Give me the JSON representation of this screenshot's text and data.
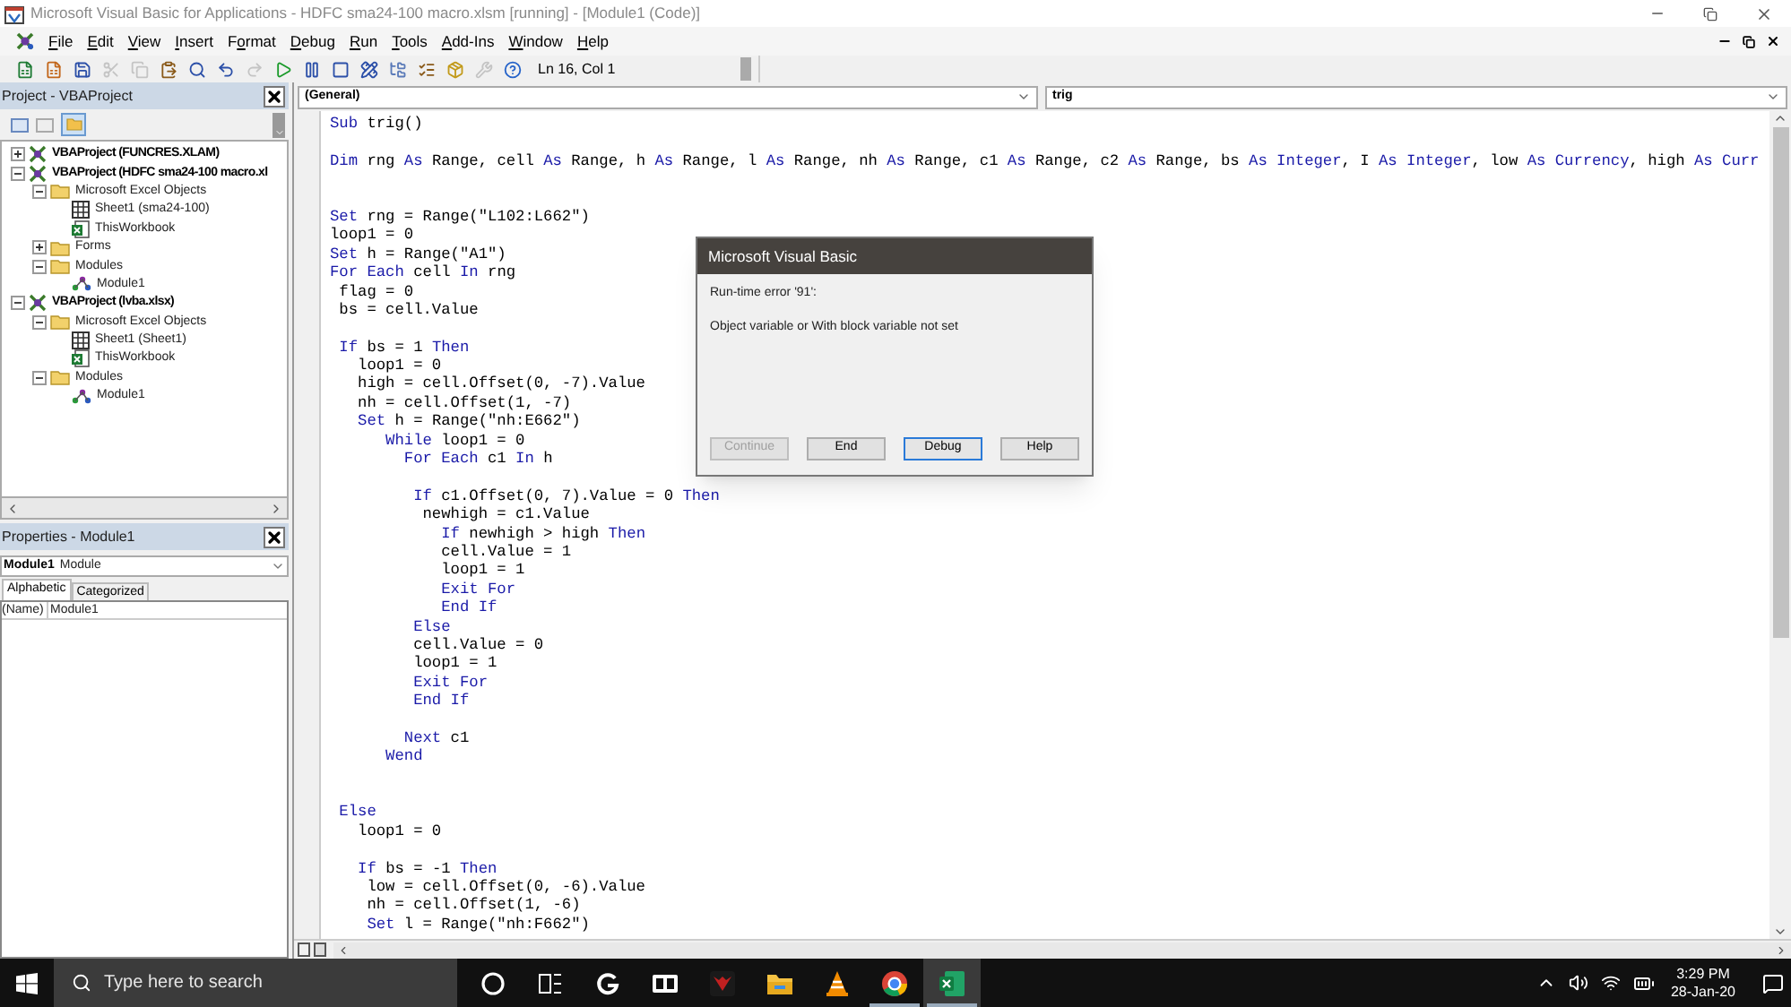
{
  "window": {
    "title": "Microsoft Visual Basic for Applications - HDFC sma24-100 macro.xlsm [running] - [Module1 (Code)]"
  },
  "menu": [
    {
      "key": "F",
      "post": "ile"
    },
    {
      "key": "E",
      "post": "dit"
    },
    {
      "key": "V",
      "post": "iew"
    },
    {
      "key": "I",
      "post": "nsert"
    },
    {
      "pre": "F",
      "key": "o",
      "post": "rmat"
    },
    {
      "key": "D",
      "post": "ebug"
    },
    {
      "key": "R",
      "post": "un"
    },
    {
      "key": "T",
      "post": "ools"
    },
    {
      "key": "A",
      "post": "dd-Ins"
    },
    {
      "key": "W",
      "post": "indow"
    },
    {
      "key": "H",
      "post": "elp"
    }
  ],
  "toolbar": {
    "buttons": [
      {
        "kind": "excel",
        "disabled": false
      },
      {
        "kind": "insert",
        "disabled": false
      },
      {
        "kind": "save",
        "disabled": false
      },
      {
        "kind": "cut",
        "disabled": true
      },
      {
        "kind": "copy",
        "disabled": true
      },
      {
        "kind": "paste",
        "disabled": false
      },
      {
        "kind": "find",
        "disabled": false
      },
      {
        "kind": "undo",
        "disabled": false
      },
      {
        "kind": "redo",
        "disabled": true
      },
      {
        "kind": "run",
        "disabled": false
      },
      {
        "kind": "break",
        "disabled": false
      },
      {
        "kind": "reset",
        "disabled": false
      },
      {
        "kind": "design",
        "disabled": false
      },
      {
        "kind": "project",
        "disabled": false
      },
      {
        "kind": "properties",
        "disabled": false
      },
      {
        "kind": "browser",
        "disabled": false
      },
      {
        "kind": "toolbox",
        "disabled": true
      },
      {
        "kind": "help",
        "disabled": false
      }
    ],
    "position": "Ln 16, Col 1"
  },
  "project": {
    "title": "Project - VBAProject",
    "tree": [
      {
        "label": "VBAProject (FUNCRES.XLAM)",
        "kind": "project",
        "expanded": false
      },
      {
        "label": "VBAProject (HDFC sma24-100 macro.xl",
        "kind": "project",
        "expanded": true,
        "children": [
          {
            "label": "Microsoft Excel Objects",
            "kind": "folder",
            "expanded": true,
            "children": [
              {
                "label": "Sheet1 (sma24-100)",
                "kind": "sheet"
              },
              {
                "label": "ThisWorkbook",
                "kind": "workbook"
              }
            ]
          },
          {
            "label": "Forms",
            "kind": "folder",
            "expanded": false
          },
          {
            "label": "Modules",
            "kind": "folder",
            "expanded": true,
            "children": [
              {
                "label": "Module1",
                "kind": "module"
              }
            ]
          }
        ]
      },
      {
        "label": "VBAProject (lvba.xlsx)",
        "kind": "project",
        "expanded": true,
        "children": [
          {
            "label": "Microsoft Excel Objects",
            "kind": "folder",
            "expanded": true,
            "children": [
              {
                "label": "Sheet1 (Sheet1)",
                "kind": "sheet"
              },
              {
                "label": "ThisWorkbook",
                "kind": "workbook"
              }
            ]
          },
          {
            "label": "Modules",
            "kind": "folder",
            "expanded": true,
            "children": [
              {
                "label": "Module1",
                "kind": "module"
              }
            ]
          }
        ]
      }
    ]
  },
  "properties": {
    "title": "Properties - Module1",
    "object_name": "Module1",
    "object_type": "Module",
    "tabs": [
      {
        "label": "Alphabetic",
        "selected": true
      },
      {
        "label": "Categorized",
        "selected": false
      }
    ],
    "rows": [
      {
        "name": "(Name)",
        "value": "Module1"
      }
    ]
  },
  "code": {
    "object": "(General)",
    "procedure": "trig",
    "lines": [
      {
        "kind": "code",
        "segments": [
          {
            "text": "Sub",
            "kind": "keyword"
          },
          {
            "text": " trig()",
            "kind": "plain"
          }
        ]
      },
      {
        "kind": "blank"
      },
      {
        "kind": "code",
        "segments": [
          {
            "text": "Dim",
            "kind": "keyword"
          },
          {
            "text": " rng ",
            "kind": "plain"
          },
          {
            "text": "As",
            "kind": "keyword"
          },
          {
            "text": " Range, cell ",
            "kind": "plain"
          },
          {
            "text": "As",
            "kind": "keyword"
          },
          {
            "text": " Range, h ",
            "kind": "plain"
          },
          {
            "text": "As",
            "kind": "keyword"
          },
          {
            "text": " Range, l ",
            "kind": "plain"
          },
          {
            "text": "As",
            "kind": "keyword"
          },
          {
            "text": " Range, nh ",
            "kind": "plain"
          },
          {
            "text": "As",
            "kind": "keyword"
          },
          {
            "text": " Range, c1 ",
            "kind": "plain"
          },
          {
            "text": "As",
            "kind": "keyword"
          },
          {
            "text": " Range, c2 ",
            "kind": "plain"
          },
          {
            "text": "As",
            "kind": "keyword"
          },
          {
            "text": " Range, bs ",
            "kind": "plain"
          },
          {
            "text": "As Integer",
            "kind": "keyword"
          },
          {
            "text": ", I ",
            "kind": "plain"
          },
          {
            "text": "As Integer",
            "kind": "keyword"
          },
          {
            "text": ", low ",
            "kind": "plain"
          },
          {
            "text": "As Currency",
            "kind": "keyword"
          },
          {
            "text": ", high ",
            "kind": "plain"
          },
          {
            "text": "As Curr",
            "kind": "keyword"
          }
        ]
      },
      {
        "kind": "blank"
      },
      {
        "kind": "blank"
      },
      {
        "kind": "code",
        "segments": [
          {
            "text": "Set",
            "kind": "keyword"
          },
          {
            "text": " rng = Range(\"L102:L662\")",
            "kind": "plain"
          }
        ]
      },
      {
        "kind": "code",
        "segments": [
          {
            "text": "loop1 = 0",
            "kind": "plain"
          }
        ]
      },
      {
        "kind": "code",
        "segments": [
          {
            "text": "Set",
            "kind": "keyword"
          },
          {
            "text": " h = Range(\"A1\")",
            "kind": "plain"
          }
        ]
      },
      {
        "kind": "code",
        "segments": [
          {
            "text": "For Each",
            "kind": "keyword"
          },
          {
            "text": " cell ",
            "kind": "plain"
          },
          {
            "text": "In",
            "kind": "keyword"
          },
          {
            "text": " rng",
            "kind": "plain"
          }
        ]
      },
      {
        "kind": "code",
        "segments": [
          {
            "text": " flag = 0",
            "kind": "plain"
          }
        ]
      },
      {
        "kind": "code",
        "segments": [
          {
            "text": " bs = cell.Value",
            "kind": "plain"
          }
        ]
      },
      {
        "kind": "blank"
      },
      {
        "kind": "code",
        "segments": [
          {
            "text": " If",
            "kind": "keyword"
          },
          {
            "text": " bs = 1 ",
            "kind": "plain"
          },
          {
            "text": "Then",
            "kind": "keyword"
          }
        ]
      },
      {
        "kind": "code",
        "segments": [
          {
            "text": "   loop1 = 0",
            "kind": "plain"
          }
        ]
      },
      {
        "kind": "code",
        "segments": [
          {
            "text": "   high = cell.Offset(0, -7).Value",
            "kind": "plain"
          }
        ]
      },
      {
        "kind": "code",
        "segments": [
          {
            "text": "   nh = cell.Offset(1, -7)",
            "kind": "plain"
          }
        ]
      },
      {
        "kind": "code",
        "segments": [
          {
            "text": "   Set",
            "kind": "keyword"
          },
          {
            "text": " h = Range(\"nh:E662\")",
            "kind": "plain"
          }
        ]
      },
      {
        "kind": "code",
        "segments": [
          {
            "text": "      While",
            "kind": "keyword"
          },
          {
            "text": " loop1 = 0",
            "kind": "plain"
          }
        ]
      },
      {
        "kind": "code",
        "segments": [
          {
            "text": "        For Each",
            "kind": "keyword"
          },
          {
            "text": " c1 ",
            "kind": "plain"
          },
          {
            "text": "In",
            "kind": "keyword"
          },
          {
            "text": " h",
            "kind": "plain"
          }
        ]
      },
      {
        "kind": "blank"
      },
      {
        "kind": "code",
        "segments": [
          {
            "text": "         If",
            "kind": "keyword"
          },
          {
            "text": " c1.Offset(0, 7).Value = 0 ",
            "kind": "plain"
          },
          {
            "text": "Then",
            "kind": "keyword"
          }
        ]
      },
      {
        "kind": "code",
        "segments": [
          {
            "text": "          newhigh = c1.Value",
            "kind": "plain"
          }
        ]
      },
      {
        "kind": "code",
        "segments": [
          {
            "text": "            If",
            "kind": "keyword"
          },
          {
            "text": " newhigh > high ",
            "kind": "plain"
          },
          {
            "text": "Then",
            "kind": "keyword"
          }
        ]
      },
      {
        "kind": "code",
        "segments": [
          {
            "text": "            cell.Value = 1",
            "kind": "plain"
          }
        ]
      },
      {
        "kind": "code",
        "segments": [
          {
            "text": "            loop1 = 1",
            "kind": "plain"
          }
        ]
      },
      {
        "kind": "code",
        "segments": [
          {
            "text": "            Exit For",
            "kind": "keyword"
          }
        ]
      },
      {
        "kind": "code",
        "segments": [
          {
            "text": "            End If",
            "kind": "keyword"
          }
        ]
      },
      {
        "kind": "code",
        "segments": [
          {
            "text": "         Else",
            "kind": "keyword"
          }
        ]
      },
      {
        "kind": "code",
        "segments": [
          {
            "text": "         cell.Value = 0",
            "kind": "plain"
          }
        ]
      },
      {
        "kind": "code",
        "segments": [
          {
            "text": "         loop1 = 1",
            "kind": "plain"
          }
        ]
      },
      {
        "kind": "code",
        "segments": [
          {
            "text": "         Exit For",
            "kind": "keyword"
          }
        ]
      },
      {
        "kind": "code",
        "segments": [
          {
            "text": "         End If",
            "kind": "keyword"
          }
        ]
      },
      {
        "kind": "blank"
      },
      {
        "kind": "code",
        "segments": [
          {
            "text": "        Next",
            "kind": "keyword"
          },
          {
            "text": " c1",
            "kind": "plain"
          }
        ]
      },
      {
        "kind": "code",
        "segments": [
          {
            "text": "      Wend",
            "kind": "keyword"
          }
        ]
      },
      {
        "kind": "blank"
      },
      {
        "kind": "blank"
      },
      {
        "kind": "code",
        "segments": [
          {
            "text": " Else",
            "kind": "keyword"
          }
        ]
      },
      {
        "kind": "code",
        "segments": [
          {
            "text": "   loop1 = 0",
            "kind": "plain"
          }
        ]
      },
      {
        "kind": "blank"
      },
      {
        "kind": "code",
        "segments": [
          {
            "text": "   If",
            "kind": "keyword"
          },
          {
            "text": " bs = -1 ",
            "kind": "plain"
          },
          {
            "text": "Then",
            "kind": "keyword"
          }
        ]
      },
      {
        "kind": "code",
        "segments": [
          {
            "text": "    low = cell.Offset(0, -6).Value",
            "kind": "plain"
          }
        ]
      },
      {
        "kind": "code",
        "segments": [
          {
            "text": "    nh = cell.Offset(1, -6)",
            "kind": "plain"
          }
        ]
      },
      {
        "kind": "code",
        "segments": [
          {
            "text": "    Set",
            "kind": "keyword"
          },
          {
            "text": " l = Range(\"nh:F662\")",
            "kind": "plain"
          }
        ]
      }
    ]
  },
  "dialog": {
    "title": "Microsoft Visual Basic",
    "messages": [
      "Run-time error '91':",
      "Object variable or With block variable not set"
    ],
    "buttons": [
      {
        "label": "Continue",
        "disabled": true,
        "focused": false
      },
      {
        "label": "End",
        "disabled": false,
        "focused": false
      },
      {
        "label": "Debug",
        "disabled": false,
        "focused": true
      },
      {
        "label": "Help",
        "disabled": false,
        "focused": false
      }
    ]
  },
  "taskbar": {
    "search": {
      "placeholder": "Type here to search"
    },
    "apps": [
      {
        "kind": "cortana",
        "selected": false,
        "running": false
      },
      {
        "kind": "taskview",
        "selected": false,
        "running": false
      },
      {
        "kind": "g",
        "selected": false,
        "running": false
      },
      {
        "kind": "reader",
        "selected": false,
        "running": false
      },
      {
        "kind": "game",
        "selected": false,
        "running": false
      },
      {
        "kind": "folder",
        "selected": false,
        "running": false
      },
      {
        "kind": "vlc",
        "selected": false,
        "running": false
      },
      {
        "kind": "chrome",
        "selected": false,
        "running": true
      },
      {
        "kind": "excel",
        "selected": true,
        "running": true
      }
    ],
    "time": "3:29 PM",
    "date": "28-Jan-20"
  }
}
